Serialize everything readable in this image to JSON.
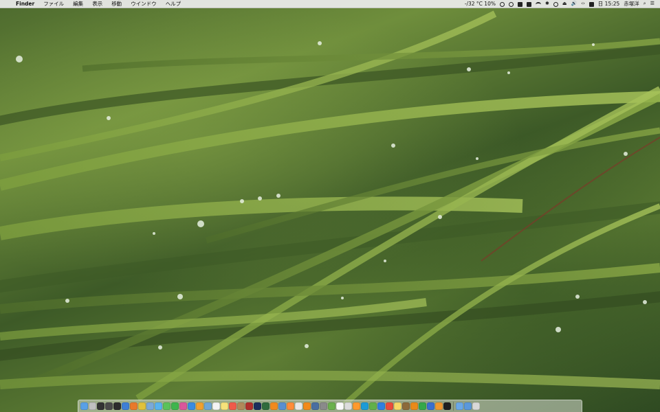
{
  "menubar": {
    "apple_glyph": "",
    "app_name": "Finder",
    "menus": [
      "ファイル",
      "編集",
      "表示",
      "移動",
      "ウインドウ",
      "ヘルプ"
    ],
    "weather": "-/32 °C 10%",
    "date_time": "日 15:25",
    "user": "赤塚洋"
  },
  "dock": {
    "apps_left": [
      "finder-icon",
      "launchpad-icon",
      "terminal-icon",
      "activity-icon",
      "dashboard-icon",
      "safari-icon",
      "firefox-icon",
      "chrome-icon",
      "mail-icon",
      "twitter-icon",
      "messages-icon",
      "facetime-icon",
      "itunes-icon",
      "appstore-icon",
      "photos-icon",
      "preview-icon",
      "textedit-icon",
      "notes-icon",
      "calendar-icon",
      "contacts-icon",
      "filezilla-icon",
      "photoshop-icon",
      "dreamweaver-icon",
      "illustrator-icon",
      "xcode-icon",
      "sublime-icon",
      "editor-icon",
      "vlc-icon",
      "quicktime-icon",
      "system-prefs-icon",
      "maps-icon",
      "reminders-icon",
      "dictionary-icon",
      "calculator-icon",
      "skype-icon",
      "evernote-icon",
      "dropbox-icon",
      "ical-icon",
      "stickies-icon",
      "chess-icon",
      "ibooks-icon",
      "numbers-icon",
      "keynote-icon",
      "pages-icon",
      "console-icon"
    ],
    "apps_right": [
      "documents-folder-icon",
      "downloads-folder-icon",
      "trash-icon"
    ],
    "colors": [
      "#5aa0e6",
      "#c0c0c0",
      "#333333",
      "#4a4a4a",
      "#2c2c2c",
      "#3e7fd6",
      "#e9792b",
      "#e0c23c",
      "#7aa9d9",
      "#59b3ee",
      "#5bc25a",
      "#3fb54d",
      "#d9579b",
      "#3a8be0",
      "#f0a030",
      "#6ea6d8",
      "#f4f4f4",
      "#f6e27a",
      "#ef5a4a",
      "#b08a5a",
      "#b0302b",
      "#1c2f5c",
      "#2f6b3c",
      "#f08a1e",
      "#5a8fd0",
      "#ff8c3a",
      "#e8e8e8",
      "#f28a1a",
      "#4a6fa0",
      "#8a8a8a",
      "#6ab04c",
      "#fafafa",
      "#dcdcdc",
      "#ff9a2e",
      "#1d9bd7",
      "#62b04a",
      "#2f7fe0",
      "#e94b3c",
      "#f7d866",
      "#8c6a3a",
      "#e98a1a",
      "#35a84a",
      "#3a6fd0",
      "#f09830",
      "#202020"
    ]
  }
}
